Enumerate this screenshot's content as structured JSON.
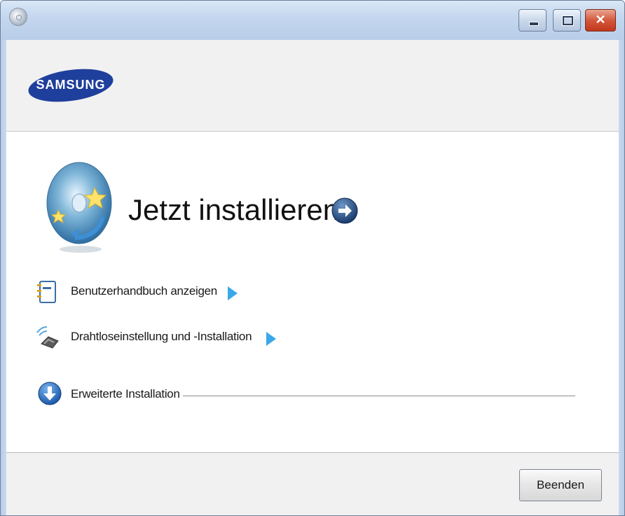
{
  "window": {
    "close_glyph": "✕"
  },
  "header": {
    "brand": "SAMSUNG"
  },
  "main": {
    "install_title": "Jetzt installieren",
    "links": [
      {
        "label": "Benutzerhandbuch anzeigen"
      },
      {
        "label": "Drahtloseinstellung und -Installation"
      }
    ],
    "advanced_label": "Erweiterte Installation"
  },
  "footer": {
    "finish_label": "Beenden"
  },
  "colors": {
    "brand_blue": "#1f3f9c",
    "accent_arrow": "#3aa8ea",
    "titlebar": "#c3d6ee",
    "close_red": "#d3583b"
  },
  "icons": {
    "app": "disc-icon",
    "install": "install-disc-icon",
    "go": "arrow-right-circle-icon",
    "manual": "manual-book-icon",
    "wireless": "wireless-printer-icon",
    "advanced": "arrow-down-circle-icon"
  }
}
